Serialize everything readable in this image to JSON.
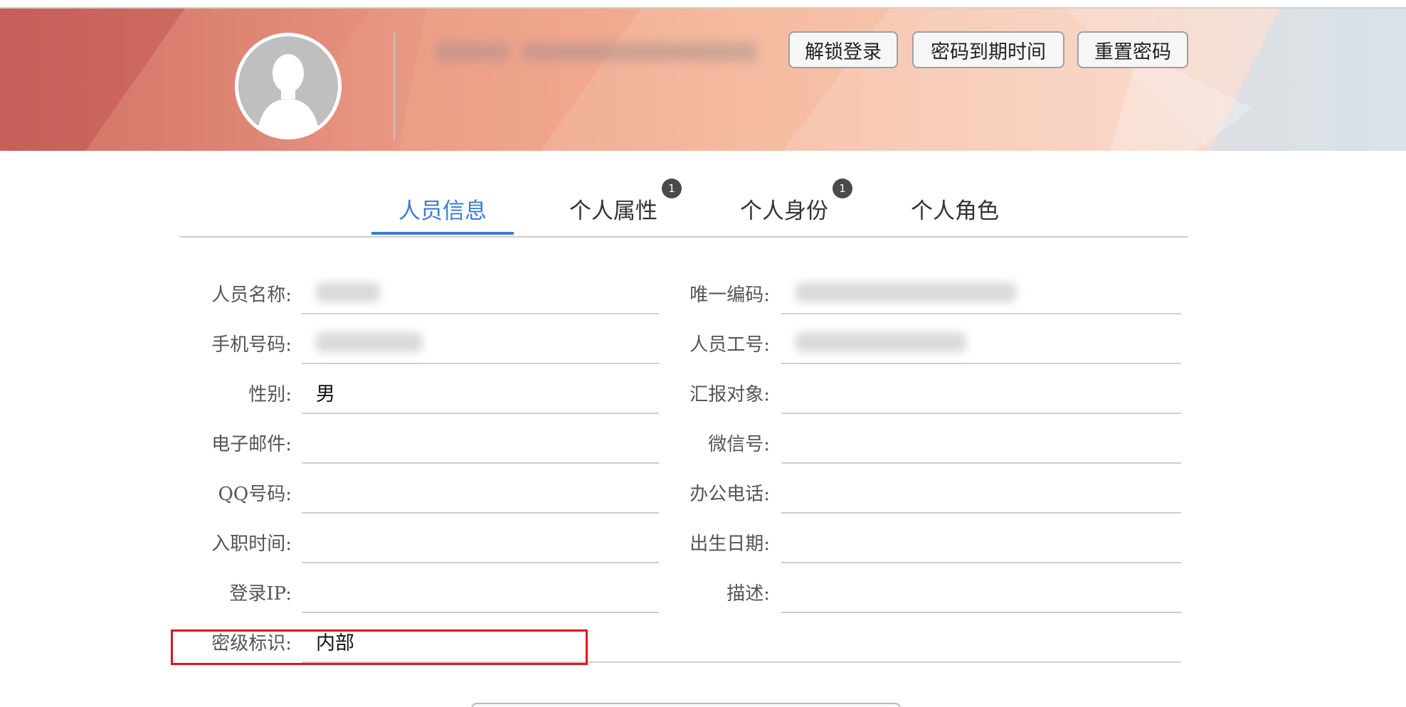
{
  "header": {
    "buttons": {
      "unlock_login": "解锁登录",
      "password_expiry": "密码到期时间",
      "reset_password": "重置密码"
    }
  },
  "tabs": [
    {
      "label": "人员信息",
      "active": true,
      "badge": null
    },
    {
      "label": "个人属性",
      "active": false,
      "badge": "1"
    },
    {
      "label": "个人身份",
      "active": false,
      "badge": "1"
    },
    {
      "label": "个人角色",
      "active": false,
      "badge": null
    }
  ],
  "form": {
    "left": [
      {
        "label": "人员名称:",
        "value": "",
        "blurred": true
      },
      {
        "label": "手机号码:",
        "value": "",
        "blurred": true
      },
      {
        "label": "性别:",
        "value": "男",
        "blurred": false
      },
      {
        "label": "电子邮件:",
        "value": "",
        "blurred": false
      },
      {
        "label": "QQ号码:",
        "value": "",
        "blurred": false
      },
      {
        "label": "入职时间:",
        "value": "",
        "blurred": false
      },
      {
        "label": "登录IP:",
        "value": "",
        "blurred": false
      },
      {
        "label": "密级标识:",
        "value": "内部",
        "blurred": false
      }
    ],
    "right": [
      {
        "label": "唯一编码:",
        "value": "",
        "blurred": true
      },
      {
        "label": "人员工号:",
        "value": "",
        "blurred": true
      },
      {
        "label": "汇报对象:",
        "value": "",
        "blurred": false
      },
      {
        "label": "微信号:",
        "value": "",
        "blurred": false
      },
      {
        "label": "办公电话:",
        "value": "",
        "blurred": false
      },
      {
        "label": "出生日期:",
        "value": "",
        "blurred": false
      },
      {
        "label": "描述:",
        "value": "",
        "blurred": false
      }
    ]
  },
  "colors": {
    "accent": "#3a7bd5",
    "highlight": "#e0141e",
    "badge": "#4a4a4a"
  }
}
